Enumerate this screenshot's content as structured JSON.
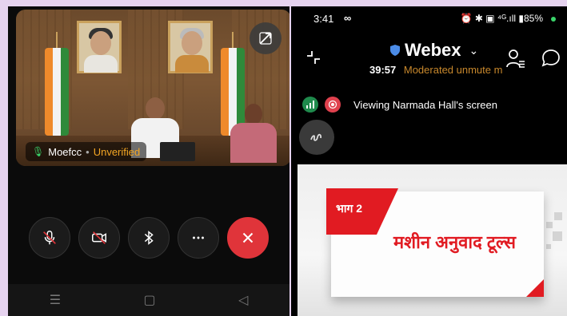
{
  "left_panel": {
    "participant_name": "Moefcc",
    "participant_status": "Unverified",
    "separator": "•",
    "controls": [
      {
        "icon": "mic-off-icon"
      },
      {
        "icon": "video-off-icon"
      },
      {
        "icon": "bluetooth-icon"
      },
      {
        "icon": "more-icon"
      },
      {
        "icon": "close-icon"
      }
    ],
    "nav": {
      "recent": "☰",
      "home": "▢",
      "back": "◁"
    }
  },
  "right_panel": {
    "status_bar": {
      "time": "3:41",
      "infinity": "∞",
      "icons": "⏰ ✱ ▣ ⁴ᴳ.ıll ▮85%"
    },
    "app_name": "Webex",
    "chevron": "⌄",
    "meeting_timer": "39:57",
    "moderation_text": "Moderated unmute m",
    "sharing_text": "Viewing Narmada Hall's screen",
    "slide": {
      "tag": "भाग 2",
      "title": "मशीन अनुवाद टूल्स"
    }
  },
  "colors": {
    "end_call": "#e0343a",
    "unverified": "#f4a623",
    "moderated": "#c8882c",
    "slide_accent": "#e11b22",
    "background": "#e6d3ef"
  }
}
